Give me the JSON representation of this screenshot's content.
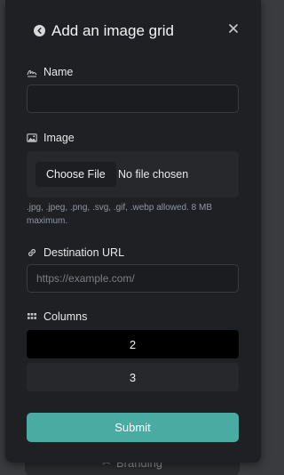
{
  "background_item": {
    "label": "Branding",
    "icon": "wand-icon"
  },
  "modal": {
    "title": "Add an image grid",
    "back_icon": "arrow-left-circle-icon",
    "close_icon": "close-icon"
  },
  "fields": {
    "name": {
      "label": "Name",
      "icon": "signature-icon",
      "value": "",
      "placeholder": ""
    },
    "image": {
      "label": "Image",
      "icon": "image-icon",
      "button_label": "Choose File",
      "status": "No file chosen",
      "help": ".jpg, .jpeg, .png, .svg, .gif, .webp allowed. 8 MB maximum."
    },
    "destination": {
      "label": "Destination URL",
      "icon": "link-icon",
      "value": "",
      "placeholder": "https://example.com/"
    },
    "columns": {
      "label": "Columns",
      "icon": "grid-icon",
      "options": [
        {
          "label": "2",
          "selected": true
        },
        {
          "label": "3",
          "selected": false
        }
      ]
    }
  },
  "submit_label": "Submit",
  "colors": {
    "accent": "#4aaba3",
    "modal_bg": "#1f2023",
    "selected_option": "#000000"
  }
}
